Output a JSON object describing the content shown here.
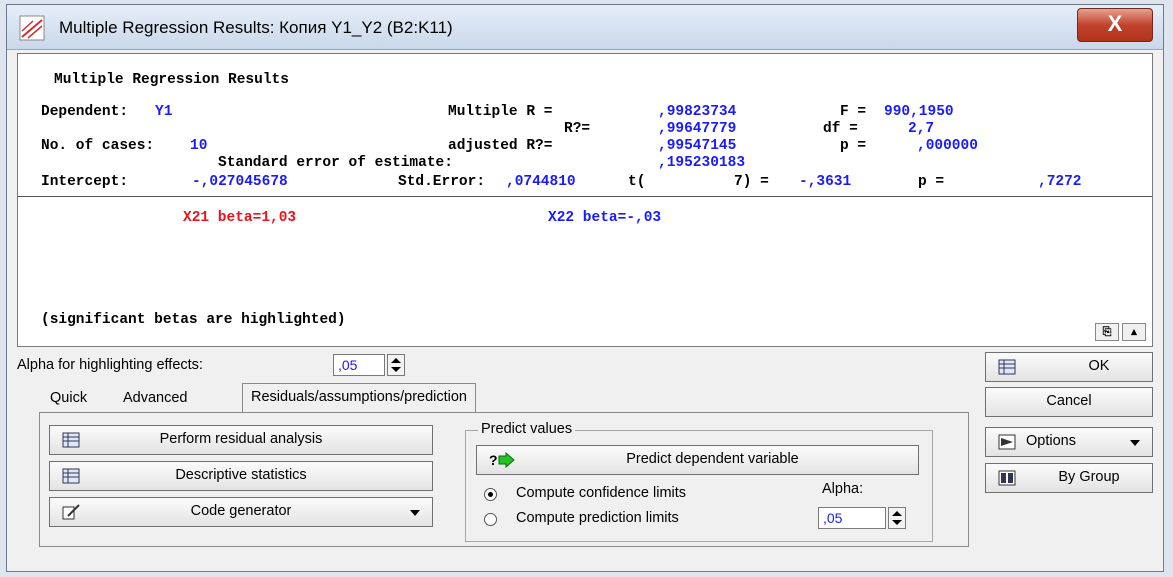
{
  "window": {
    "title": "Multiple Regression Results: Копия Y1_Y2 (B2:K11)",
    "close_label": "X"
  },
  "results": {
    "heading": "Multiple Regression Results",
    "dependent_label": "Dependent:",
    "dependent_value": "Y1",
    "cases_label": "No. of cases:",
    "cases_value": "10",
    "multiple_r_label": "Multiple R =",
    "multiple_r_value": ",99823734",
    "r2_label": "R?=",
    "r2_value": ",99647779",
    "adj_r2_label": "adjusted R?=",
    "adj_r2_value": ",99547145",
    "f_label": "F =",
    "f_value": "990,1950",
    "df_label": "df =",
    "df_value": "2,7",
    "p_label": "p =",
    "p_value": ",000000",
    "se_label": "Standard error of estimate:",
    "se_value": ",195230183",
    "intercept_line_a": "Intercept:",
    "intercept_value": "-,027045678",
    "std_error_label": "Std.Error:",
    "std_error_value": ",0744810",
    "t_label": "t(",
    "t_df": "7) =",
    "t_value": "-,3631",
    "p2_label": "p =",
    "p2_value": ",7272",
    "beta1": "X21 beta=1,03",
    "beta2": "X22 beta=-,03",
    "note": "(significant betas are highlighted)"
  },
  "alpha": {
    "label": "Alpha for highlighting effects:",
    "value": ",05"
  },
  "tabs": [
    "Quick",
    "Advanced",
    "Residuals/assumptions/prediction"
  ],
  "actions": {
    "residual": "Perform residual analysis",
    "descriptive": "Descriptive statistics",
    "codegen": "Code generator"
  },
  "predict": {
    "group_title": "Predict values",
    "button": "Predict dependent variable",
    "conf": "Compute confidence limits",
    "pred": "Compute prediction limits",
    "alpha_label": "Alpha:",
    "alpha_value": ",05"
  },
  "side": {
    "ok": "OK",
    "cancel": "Cancel",
    "options": "Options",
    "bygroup": "By Group"
  },
  "colors": {
    "accent_blue": "#1a1aff",
    "highlight_red": "#e8141c"
  }
}
